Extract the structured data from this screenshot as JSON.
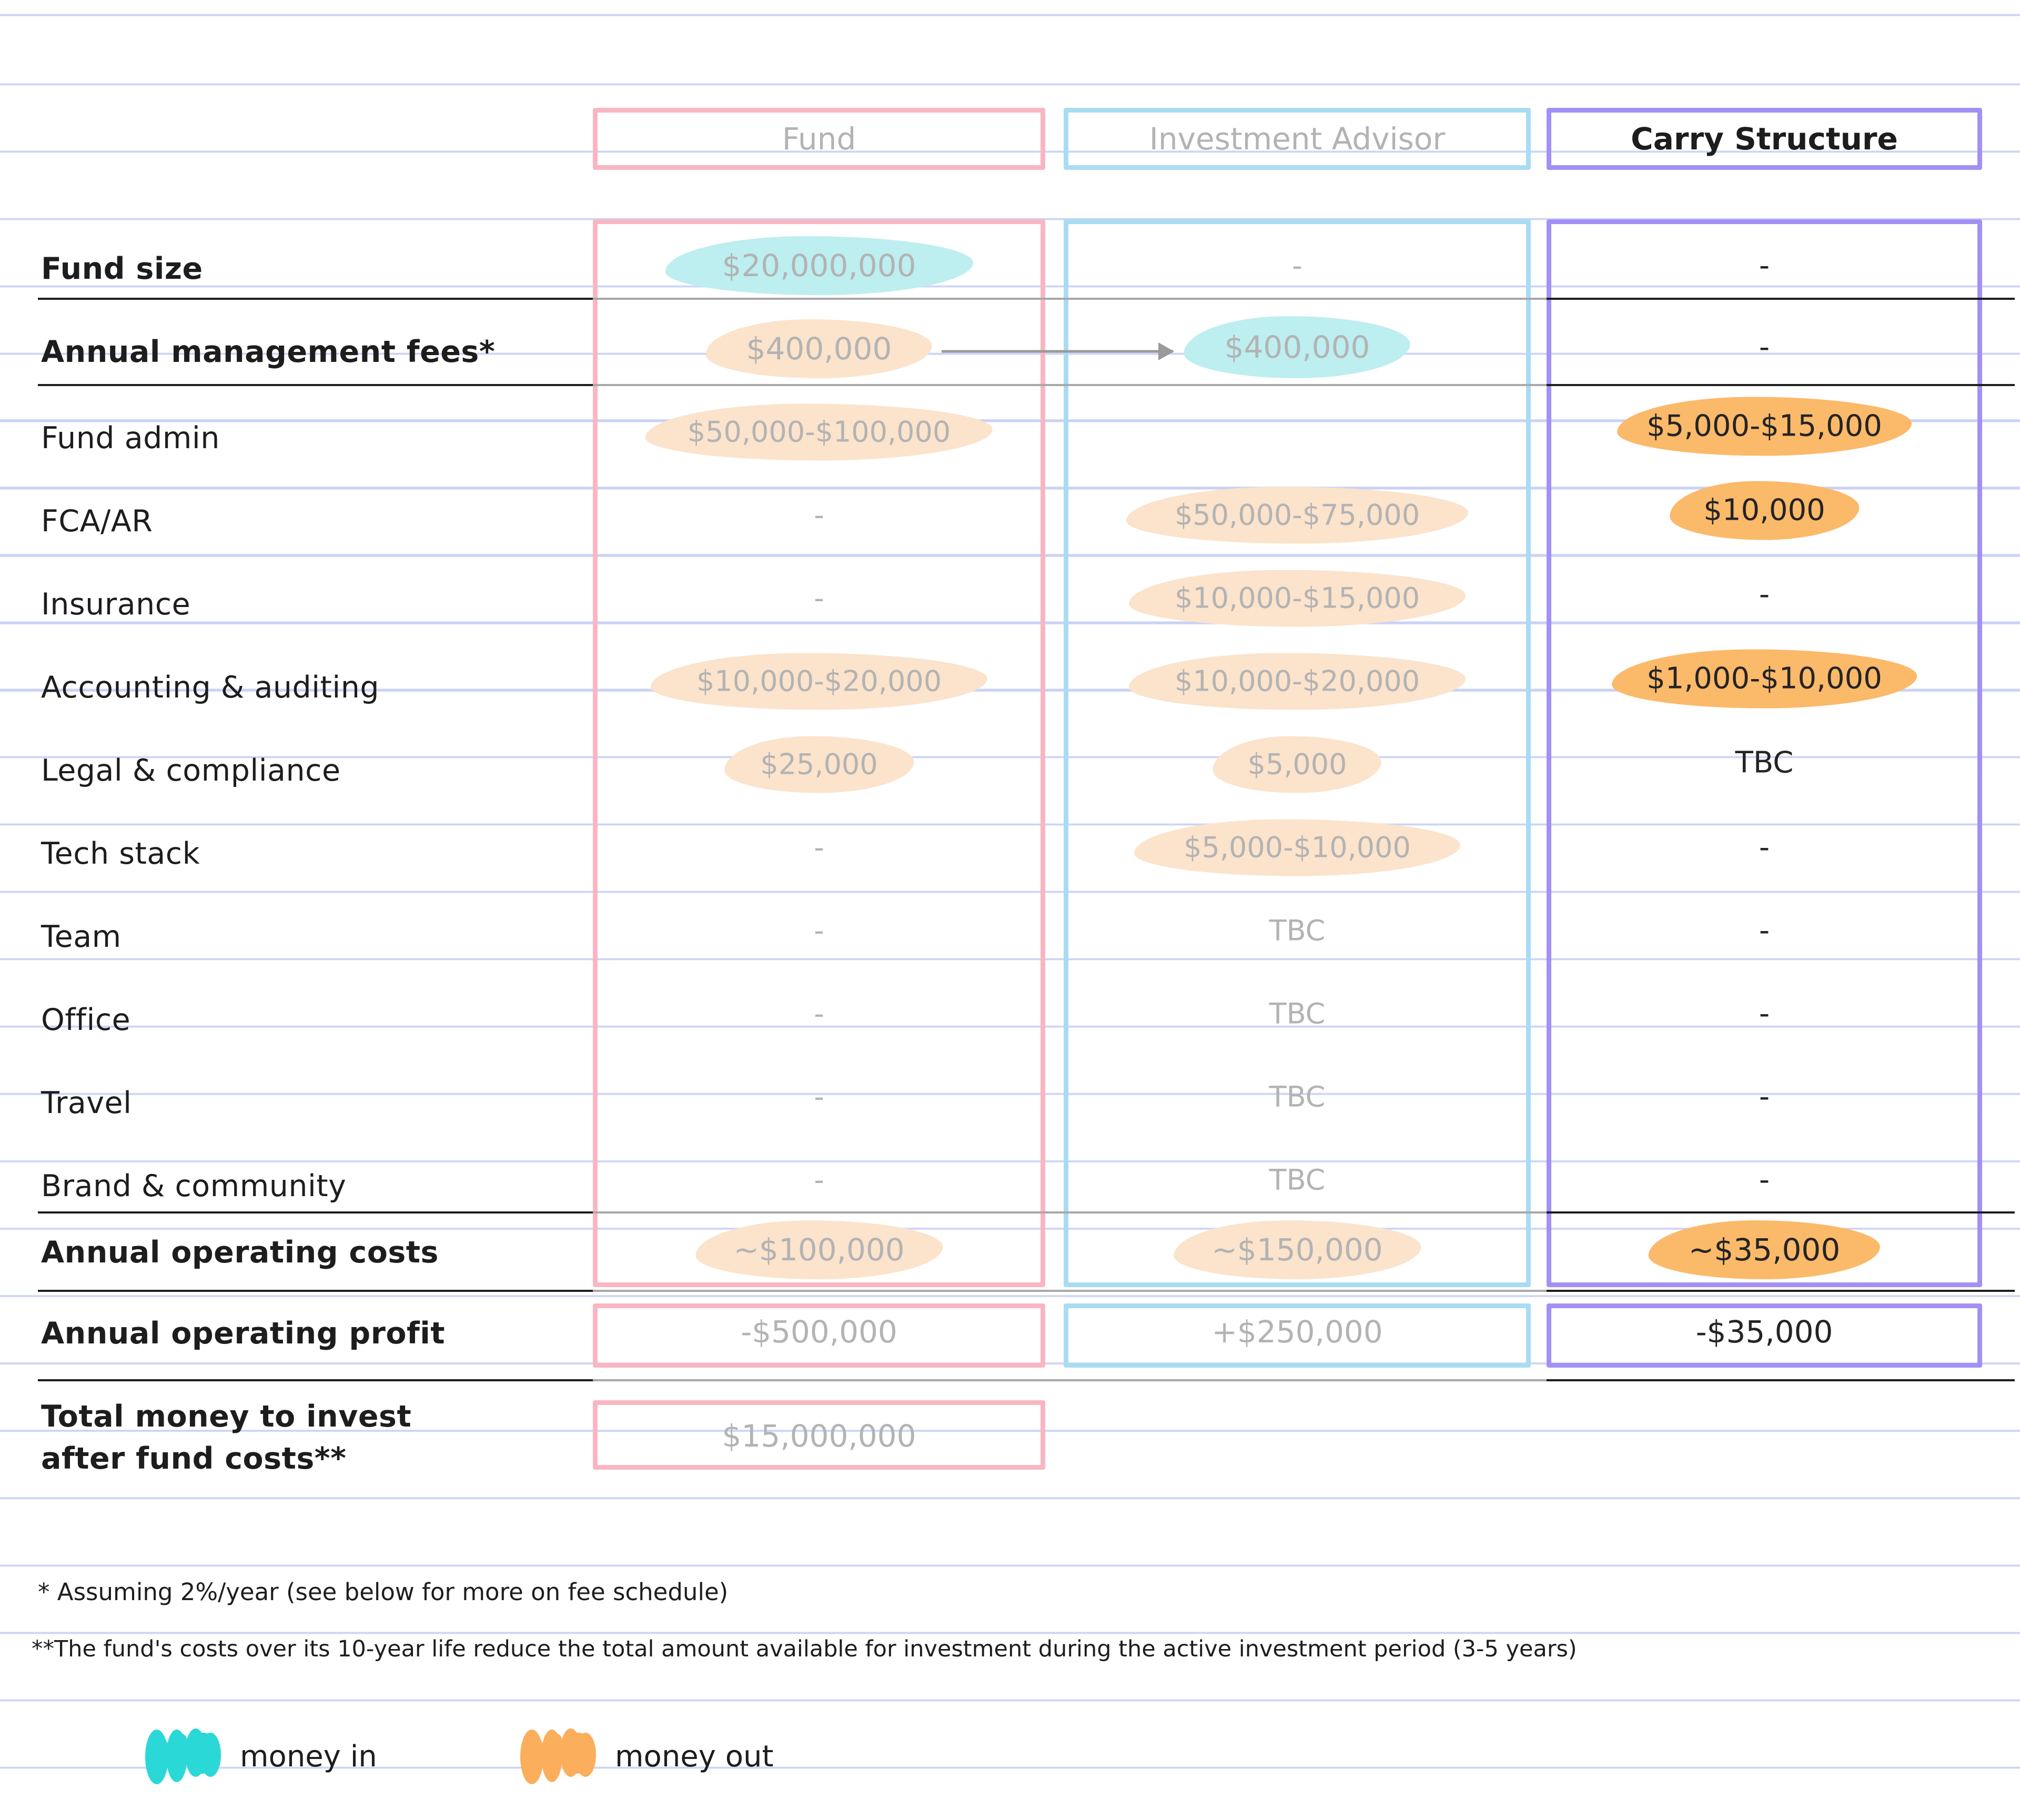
{
  "columns": [
    {
      "key": "fund",
      "label": "Fund",
      "accent": "#f9b6c2",
      "emphasis": "muted"
    },
    {
      "key": "advisor",
      "label": "Investment Advisor",
      "accent": "#a9dcf2",
      "emphasis": "muted"
    },
    {
      "key": "carry",
      "label": "Carry Structure",
      "accent": "#a390f5",
      "emphasis": "dark"
    }
  ],
  "rows": [
    {
      "label": "Fund size",
      "fund": "$20,000,000",
      "fund_hl": "teal",
      "advisor": "-",
      "advisor_hl": "none",
      "carry": "-",
      "carry_hl": "none"
    },
    {
      "label": "Annual management fees*",
      "fund": "$400,000",
      "fund_hl": "peach",
      "advisor": "$400,000",
      "advisor_hl": "teal",
      "carry": "-",
      "carry_hl": "none"
    },
    {
      "label": "Fund admin",
      "fund": "$50,000-$100,000",
      "fund_hl": "peach",
      "advisor": "",
      "advisor_hl": "none",
      "carry": "$5,000-$15,000",
      "carry_hl": "orange"
    },
    {
      "label": "FCA/AR",
      "fund": "-",
      "fund_hl": "none",
      "advisor": "$50,000-$75,000",
      "advisor_hl": "peach",
      "carry": "$10,000",
      "carry_hl": "orange"
    },
    {
      "label": "Insurance",
      "fund": "-",
      "fund_hl": "none",
      "advisor": "$10,000-$15,000",
      "advisor_hl": "peach",
      "carry": "-",
      "carry_hl": "none"
    },
    {
      "label": "Accounting & auditing",
      "fund": "$10,000-$20,000",
      "fund_hl": "peach",
      "advisor": "$10,000-$20,000",
      "advisor_hl": "peach",
      "carry": "$1,000-$10,000",
      "carry_hl": "orange"
    },
    {
      "label": "Legal & compliance",
      "fund": "$25,000",
      "fund_hl": "peach",
      "advisor": "$5,000",
      "advisor_hl": "peach",
      "carry": "TBC",
      "carry_hl": "none"
    },
    {
      "label": "Tech stack",
      "fund": "-",
      "fund_hl": "none",
      "advisor": "$5,000-$10,000",
      "advisor_hl": "peach",
      "carry": "-",
      "carry_hl": "none"
    },
    {
      "label": "Team",
      "fund": "-",
      "fund_hl": "none",
      "advisor": "TBC",
      "advisor_hl": "none",
      "carry": "-",
      "carry_hl": "none"
    },
    {
      "label": "Office",
      "fund": "-",
      "fund_hl": "none",
      "advisor": "TBC",
      "advisor_hl": "none",
      "carry": "-",
      "carry_hl": "none"
    },
    {
      "label": "Travel",
      "fund": "-",
      "fund_hl": "none",
      "advisor": "TBC",
      "advisor_hl": "none",
      "carry": "-",
      "carry_hl": "none"
    },
    {
      "label": "Brand & community",
      "fund": "-",
      "fund_hl": "none",
      "advisor": "TBC",
      "advisor_hl": "none",
      "carry": "-",
      "carry_hl": "none"
    },
    {
      "label": "Annual operating costs",
      "fund": "~$100,000",
      "fund_hl": "peach",
      "advisor": "~$150,000",
      "advisor_hl": "peach",
      "carry": "~$35,000",
      "carry_hl": "orange"
    },
    {
      "label": "Annual operating profit",
      "fund": "-$500,000",
      "fund_hl": "none",
      "advisor": "+$250,000",
      "advisor_hl": "none",
      "carry": "-$35,000",
      "carry_hl": "none"
    },
    {
      "label": "Total money to invest after fund costs**",
      "label_line1": "Total money to invest",
      "label_line2": "after fund costs**",
      "fund": "$15,000,000",
      "fund_hl": "none",
      "advisor": "",
      "advisor_hl": "none",
      "carry": "",
      "carry_hl": "none"
    }
  ],
  "footnotes": {
    "one": "* Assuming 2%/year (see below for more on fee schedule)",
    "two": "**The fund's costs over its 10-year life reduce the total amount available for investment during the active investment period (3-5 years)"
  },
  "legend": {
    "money_in": {
      "label": "money in",
      "color": "#2bd8d8"
    },
    "money_out": {
      "label": "money out",
      "color": "#fbae5c"
    }
  },
  "colors": {
    "fund_accent": "#f9b6c2",
    "advisor_accent": "#a9dcf2",
    "carry_accent": "#a390f5",
    "highlight_teal": "#bdeef0",
    "highlight_peach": "#fbe3cc",
    "highlight_orange": "#fbb96a",
    "muted_text": "#b3b3b3",
    "dark_text": "#1d1d1d",
    "paper_rule": "#c9d2f5"
  },
  "arrow": {
    "name": "fees-flow-arrow",
    "from": "fund.annual_management_fees",
    "to": "advisor.annual_management_fees"
  }
}
